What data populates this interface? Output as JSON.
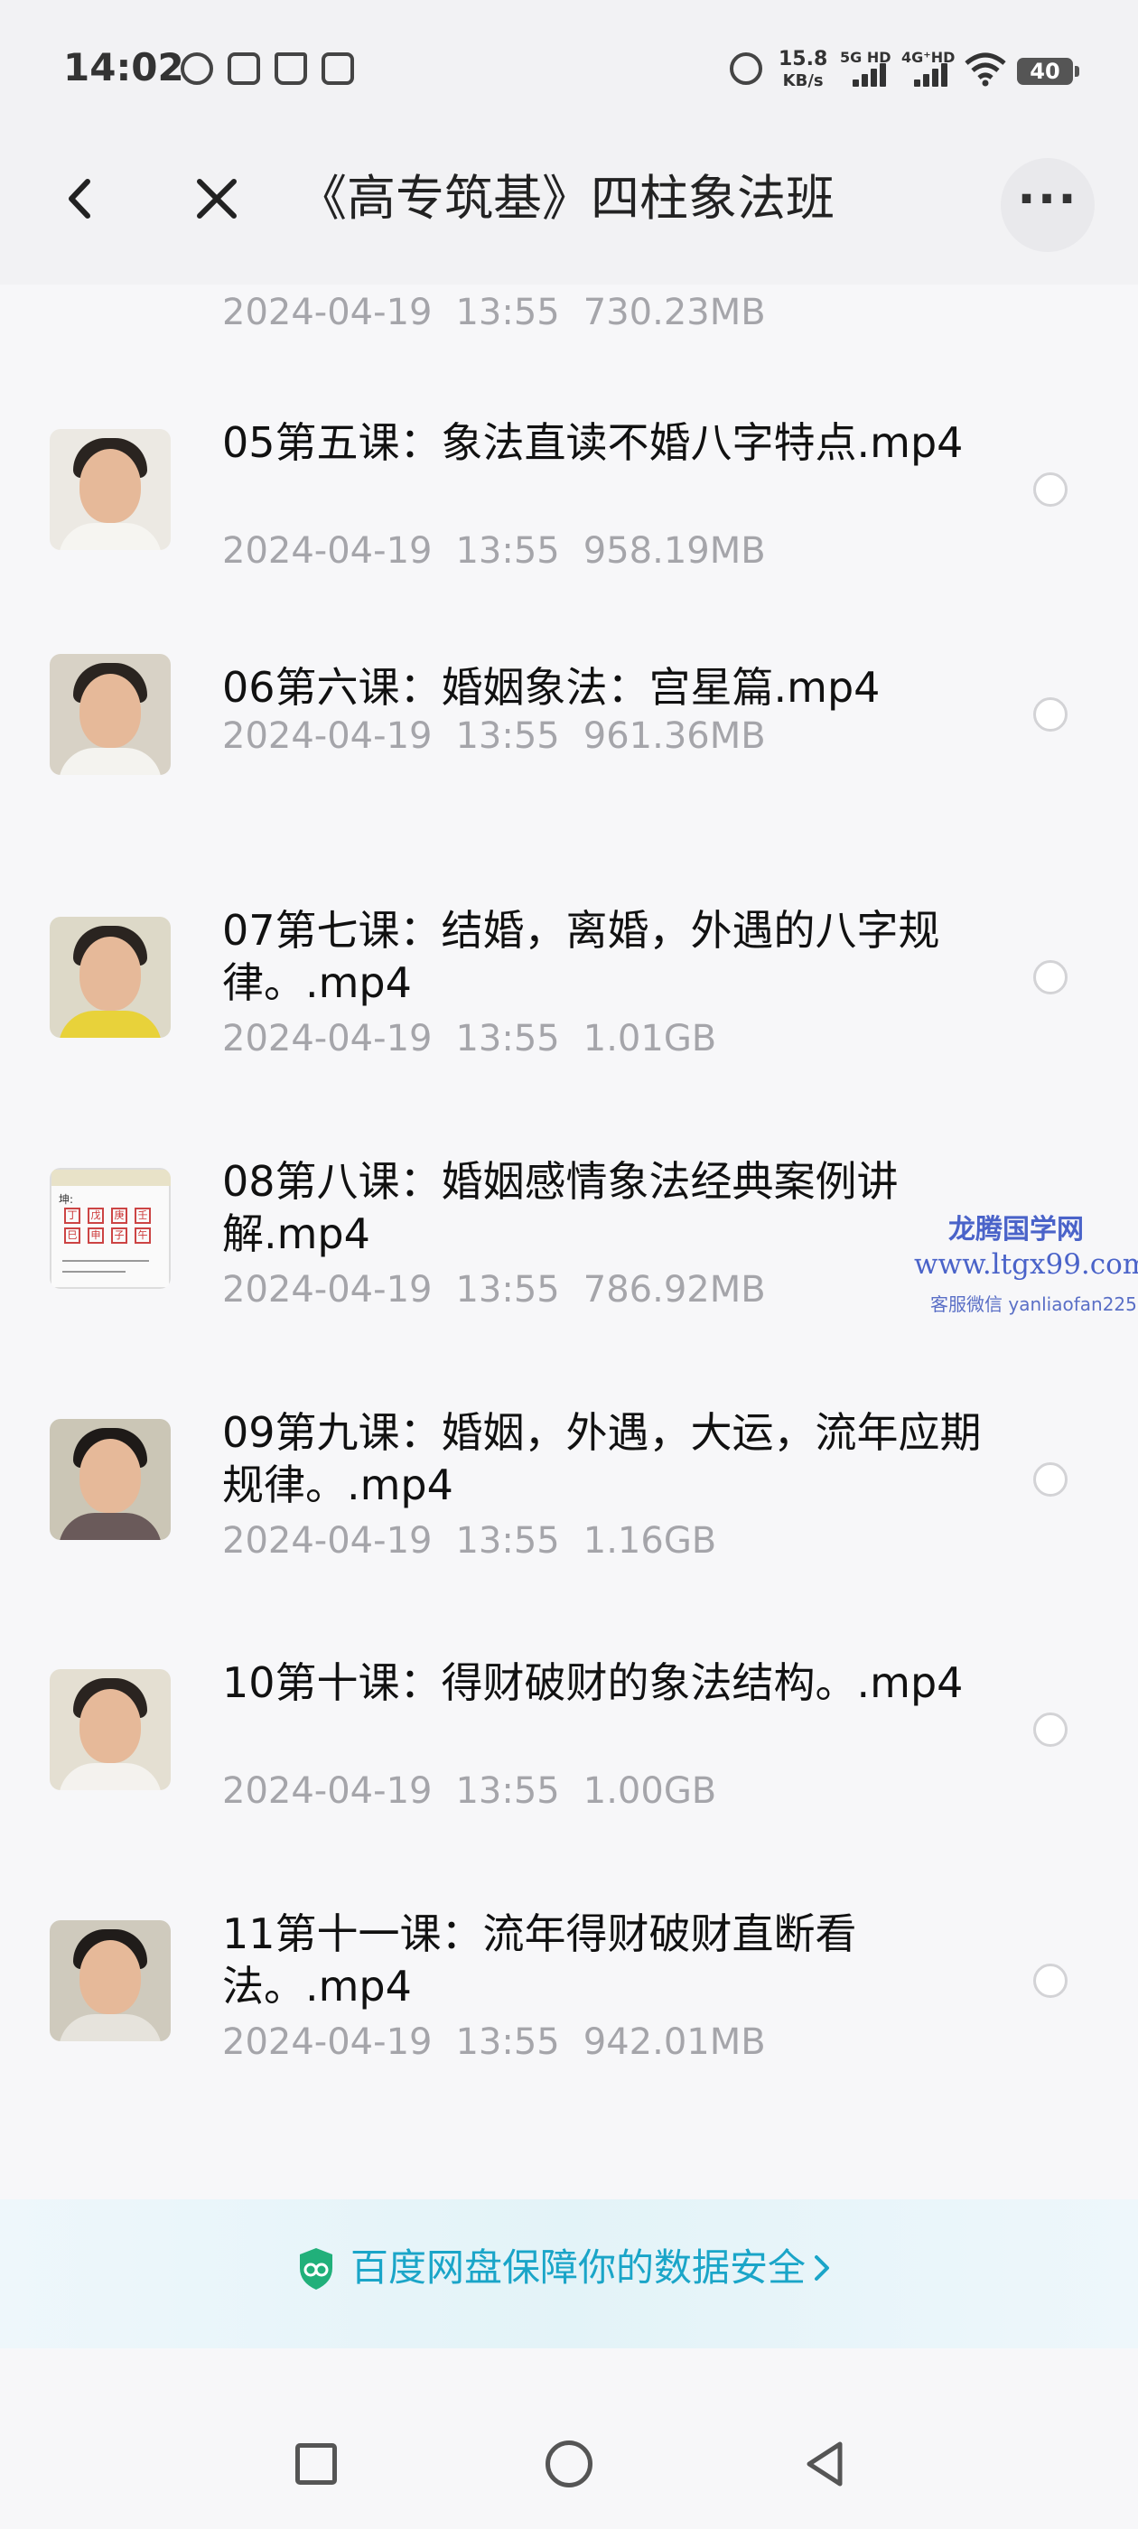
{
  "status_bar": {
    "time": "14:02",
    "net_speed_value": "15.8",
    "net_speed_unit": "KB/s",
    "net1": "5G HD",
    "net2": "4G⁺HD",
    "battery": "40",
    "icons": [
      "k-icon",
      "image-icon",
      "hand-icon",
      "box-icon",
      "alarm-icon",
      "signal-icon",
      "signal-icon",
      "wifi-icon",
      "battery-icon"
    ]
  },
  "header": {
    "title": "《高专筑基》四柱象法班",
    "back_icon": "chevron-left-icon",
    "close_icon": "close-icon",
    "more_icon": "more-icon"
  },
  "files": [
    {
      "title": "",
      "date": "2024-04-19",
      "time": "13:55",
      "size": "730.23MB"
    },
    {
      "title": "05第五课：象法直读不婚八字特点.mp4",
      "date": "2024-04-19",
      "time": "13:55",
      "size": "958.19MB"
    },
    {
      "title": "06第六课：婚姻象法：宫星篇.mp4",
      "date": "2024-04-19",
      "time": "13:55",
      "size": "961.36MB"
    },
    {
      "title": "07第七课：结婚，离婚，外遇的八字规律。.mp4",
      "date": "2024-04-19",
      "time": "13:55",
      "size": "1.01GB"
    },
    {
      "title": "08第八课：婚姻感情象法经典案例讲解.mp4",
      "date": "2024-04-19",
      "time": "13:55",
      "size": "786.92MB"
    },
    {
      "title": "09第九课：婚姻，外遇，大运，流年应期规律。.mp4",
      "date": "2024-04-19",
      "time": "13:55",
      "size": "1.16GB"
    },
    {
      "title": "10第十课：得财破财的象法结构。.mp4",
      "date": "2024-04-19",
      "time": "13:55",
      "size": "1.00GB"
    },
    {
      "title": "11第十一课：流年得财破财直断看法。.mp4",
      "date": "2024-04-19",
      "time": "13:55",
      "size": "942.01MB"
    }
  ],
  "thumb_board": {
    "label": "坤:",
    "cells_top": [
      "丁",
      "戊",
      "庚",
      "壬"
    ],
    "cells_bottom": [
      "巳",
      "申",
      "子",
      "午"
    ]
  },
  "watermark": {
    "line1": "龙腾国学网",
    "line2": "www.ltgx99.com",
    "line3": "客服微信 yanliaofan225"
  },
  "banner": {
    "text": "百度网盘保障你的数据安全",
    "icon": "shield-icon"
  },
  "system_nav": {
    "icons": [
      "recents-icon",
      "home-icon",
      "back-icon"
    ]
  },
  "colors": {
    "accent": "#1aa5c8",
    "meta_text": "#a5a5aa",
    "watermark": "#4a63c9"
  }
}
